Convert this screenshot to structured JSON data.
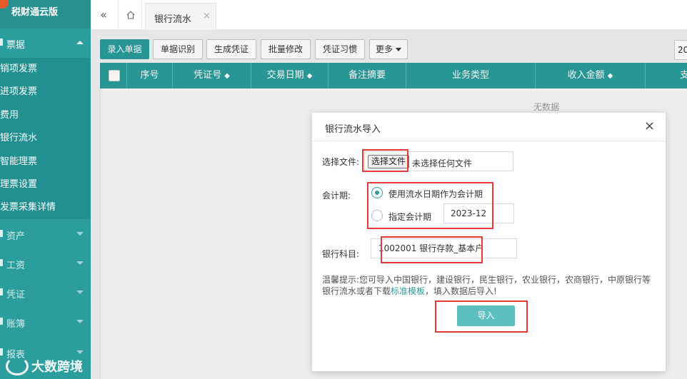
{
  "app": {
    "brand_name": "税财通云版"
  },
  "sidebar": {
    "groups": [
      {
        "label": "票据",
        "expanded": true,
        "items": [
          "销项发票",
          "进项发票",
          "费用",
          "银行流水",
          "智能理票",
          "理票设置",
          "发票采集详情"
        ]
      },
      {
        "label": "资产",
        "expanded": false
      },
      {
        "label": "工资",
        "expanded": false
      },
      {
        "label": "凭证",
        "expanded": false
      },
      {
        "label": "账簿",
        "expanded": false
      },
      {
        "label": "报表",
        "expanded": false
      }
    ]
  },
  "watermark": "大数跨境",
  "tabbar": {
    "collapse_icon": "«",
    "home_icon": "home-icon",
    "active_tab": "银行流水",
    "close_icon": "×"
  },
  "toolbar": {
    "buttons": [
      "录入单据",
      "单据识别",
      "生成凭证",
      "批量修改",
      "凭证习惯",
      "更多"
    ],
    "year_value": "20"
  },
  "table": {
    "columns": [
      "序号",
      "凭证号",
      "交易日期",
      "备注摘要",
      "业务类型",
      "收入金额",
      "支"
    ],
    "empty_text": "无数据"
  },
  "dialog": {
    "title": "银行流水导入",
    "close": "×",
    "file_label": "选择文件:",
    "file_button": "选择文件",
    "file_status": "未选择任何文件",
    "period_label": "会计期:",
    "radio_option1": "使用流水日期作为会计期",
    "radio_option2": "指定会计期",
    "period_value": "2023-12",
    "subject_label": "银行科目:",
    "subject_value": "1002001 银行存款_基本户",
    "tip_part1": "温馨提示:您可导入中国银行，建设银行，民生银行，农业银行，农商银行，中原银行等银行流水或者下载",
    "tip_link": "标准模板",
    "tip_part2": "，填入数据后导入!",
    "import_button": "导入"
  },
  "colors": {
    "accent": "#2b9d9d",
    "import_button": "#5cc0c0",
    "highlight": "#e53935"
  }
}
